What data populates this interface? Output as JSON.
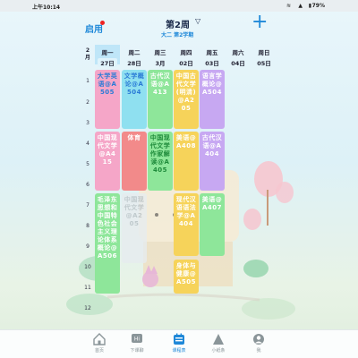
{
  "status_bar": {
    "time": "上午10:14",
    "battery": "79%"
  },
  "header": {
    "left_button": "启用",
    "week_title": "第2周",
    "term": "大二 第2学期"
  },
  "month": {
    "label": "2\n月"
  },
  "days": [
    {
      "name": "周一",
      "date": "27日",
      "today": true
    },
    {
      "name": "周二",
      "date": "28日",
      "today": false
    },
    {
      "name": "周三",
      "date": "3月",
      "today": false
    },
    {
      "name": "周四",
      "date": "02日",
      "today": false
    },
    {
      "name": "周五",
      "date": "03日",
      "today": false
    },
    {
      "name": "周六",
      "date": "04日",
      "today": false
    },
    {
      "name": "周日",
      "date": "05日",
      "today": false
    }
  ],
  "periods": [
    "1",
    "2",
    "3",
    "4",
    "5",
    "6",
    "7",
    "8",
    "9",
    "10",
    "11",
    "12"
  ],
  "courses": [
    {
      "text": "大学英语@A505",
      "color": "#f5a6c8",
      "text_color": "#2a7bd6"
    },
    {
      "text": "文学概论@A504",
      "color": "#8fe0f0",
      "text_color": "#2a7bd6"
    },
    {
      "text": "古代汉语@A413",
      "color": "#8ee69a",
      "text_color": "#ffffff"
    },
    {
      "text": "中国古代文学(明清)@A205",
      "color": "#f6d35a",
      "text_color": "#ffffff"
    },
    {
      "text": "语言学概论@A504",
      "color": "#c7a8f2",
      "text_color": "#ffffff"
    },
    {
      "text": "中国现代文学@A415",
      "color": "#f5a6c8",
      "text_color": "#ffffff"
    },
    {
      "text": "体育",
      "color": "#f28a8a",
      "text_color": "#ffffff"
    },
    {
      "text": "中国现代文学作家解读@A405",
      "color": "#8ee69a",
      "text_color": "#1e8a3a"
    },
    {
      "text": "美语@A408",
      "color": "#f6d35a",
      "text_color": "#ffffff"
    },
    {
      "text": "古代汉语@A404",
      "color": "#c7a8f2",
      "text_color": "#ffffff"
    },
    {
      "text": "毛泽东思想和中国特色社会主义理论体系概论@A506",
      "color": "#8ee69a",
      "text_color": "#ffffff"
    },
    {
      "text": "中国现代文学@A205",
      "color": "#e7ecef",
      "text_color": "#b7c0c4"
    },
    {
      "text": "现代汉语语法学@A404",
      "color": "#f6d35a",
      "text_color": "#ffffff"
    },
    {
      "text": "美语@A407",
      "color": "#8ee69a",
      "text_color": "#ffffff"
    },
    {
      "text": "身体与健康@A505",
      "color": "#f6d35a",
      "text_color": "#ffffff"
    }
  ],
  "nav": [
    {
      "label": "首页",
      "icon": "home-icon",
      "active": false
    },
    {
      "label": "下课聊",
      "icon": "chat-icon",
      "active": false
    },
    {
      "label": "课程表",
      "icon": "schedule-icon",
      "active": true
    },
    {
      "label": "小纸条",
      "icon": "note-icon",
      "active": false
    },
    {
      "label": "我",
      "icon": "user-icon",
      "active": false
    }
  ],
  "colors": {
    "accent": "#1e88d8",
    "today_bg": "#bfe6f8"
  }
}
